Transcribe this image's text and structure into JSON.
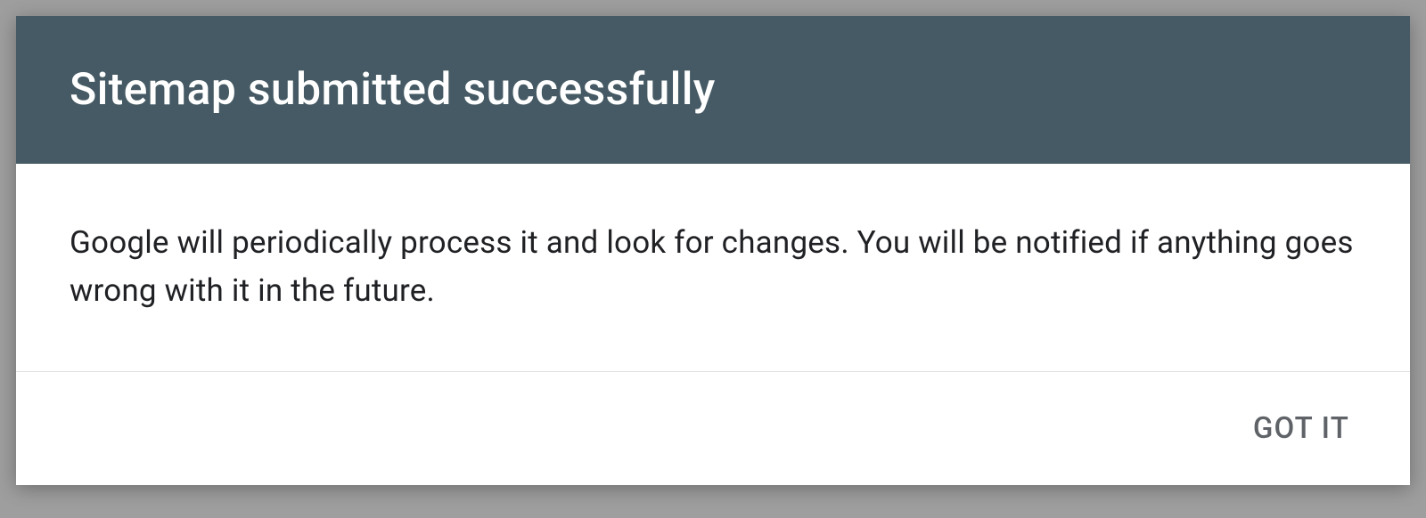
{
  "dialog": {
    "title": "Sitemap submitted successfully",
    "message": "Google will periodically process it and look for changes. You will be notified if anything goes wrong with it in the future.",
    "actions": {
      "confirm": "GOT IT"
    }
  },
  "colors": {
    "header_bg": "#455a64",
    "body_bg": "#ffffff",
    "backdrop": "#9e9e9e",
    "title_text": "#ffffff",
    "body_text": "#202124",
    "button_text": "#5f6368"
  }
}
